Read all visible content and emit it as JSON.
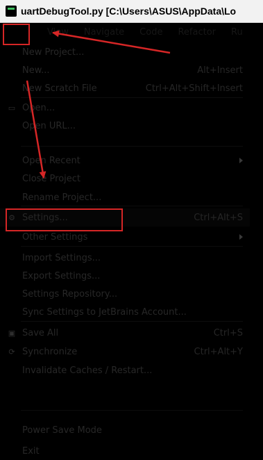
{
  "window": {
    "title": "uartDebugTool.py [C:\\Users\\ASUS\\AppData\\Lo"
  },
  "menubar": {
    "file_label": "",
    "items": [
      "View",
      "Navigate",
      "Code",
      "Refactor",
      "Ru"
    ]
  },
  "file_menu": {
    "items": [
      {
        "label": "New Project...",
        "shortcut": "",
        "submenu": false,
        "icon": ""
      },
      {
        "label": "New...",
        "shortcut": "Alt+Insert",
        "submenu": false,
        "icon": ""
      },
      {
        "label": "New Scratch File",
        "shortcut": "Ctrl+Alt+Shift+Insert",
        "submenu": false,
        "icon": ""
      },
      {
        "label": "Open...",
        "shortcut": "",
        "submenu": false,
        "icon": "folder-icon"
      },
      {
        "label": "Open URL...",
        "shortcut": "",
        "submenu": false,
        "icon": ""
      },
      {
        "label": "Open Recent",
        "shortcut": "",
        "submenu": true,
        "icon": ""
      },
      {
        "label": "Close Project",
        "shortcut": "",
        "submenu": false,
        "icon": ""
      },
      {
        "label": "Rename Project...",
        "shortcut": "",
        "submenu": false,
        "icon": ""
      },
      {
        "label": "Settings...",
        "shortcut": "Ctrl+Alt+S",
        "submenu": false,
        "icon": "wrench-icon"
      },
      {
        "label": "Other Settings",
        "shortcut": "",
        "submenu": true,
        "icon": ""
      },
      {
        "label": "Import Settings...",
        "shortcut": "",
        "submenu": false,
        "icon": ""
      },
      {
        "label": "Export Settings...",
        "shortcut": "",
        "submenu": false,
        "icon": ""
      },
      {
        "label": "Settings Repository...",
        "shortcut": "",
        "submenu": false,
        "icon": ""
      },
      {
        "label": "Sync Settings to JetBrains Account...",
        "shortcut": "",
        "submenu": false,
        "icon": ""
      },
      {
        "label": "Save All",
        "shortcut": "Ctrl+S",
        "submenu": false,
        "icon": "save-icon"
      },
      {
        "label": "Synchronize",
        "shortcut": "Ctrl+Alt+Y",
        "submenu": false,
        "icon": "sync-icon"
      },
      {
        "label": "Invalidate Caches / Restart...",
        "shortcut": "",
        "submenu": false,
        "icon": ""
      },
      {
        "label": "Power Save Mode",
        "shortcut": "",
        "submenu": false,
        "icon": ""
      },
      {
        "label": "Exit",
        "shortcut": "",
        "submenu": false,
        "icon": ""
      }
    ]
  },
  "colors": {
    "annotation": "#d62626"
  }
}
